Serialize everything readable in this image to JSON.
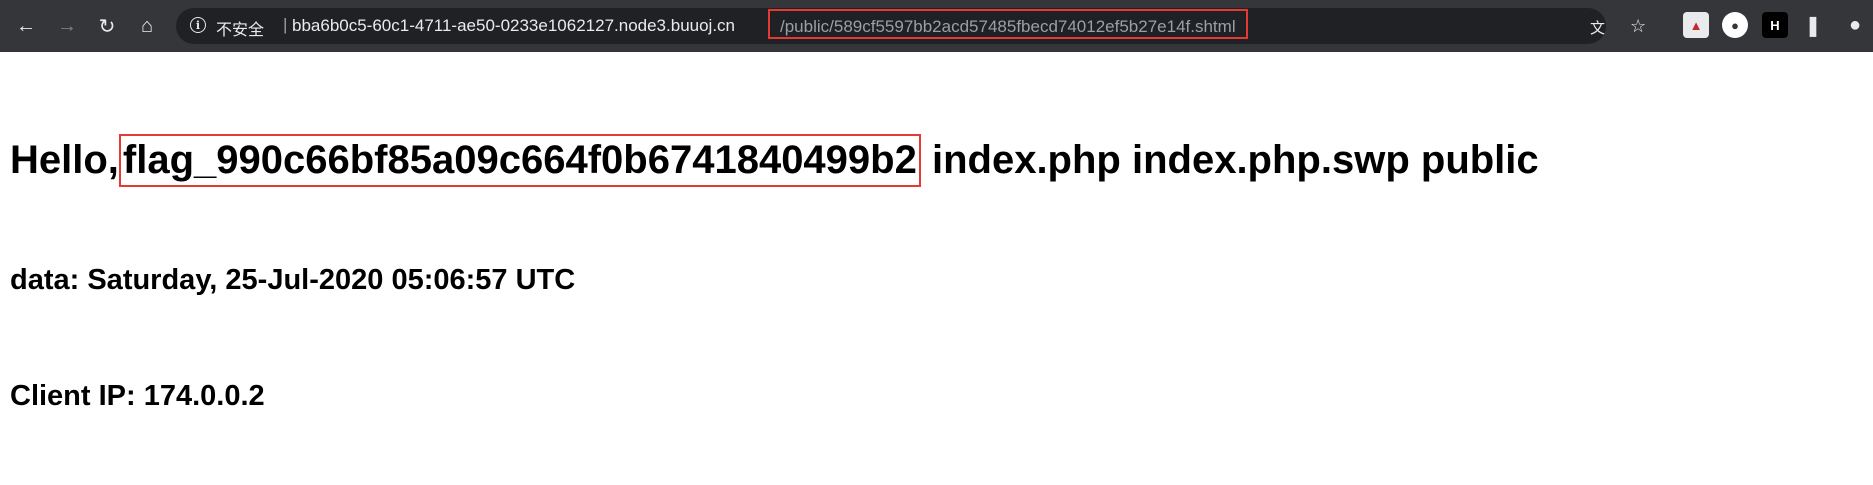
{
  "browser": {
    "security_label": "不安全",
    "separator": "|",
    "url_host": "bba6b0c5-60c1-4711-ae50-0233e1062127.node3.buuoj.cn",
    "url_path": "/public/589cf5597bb2acd57485fbecd74012ef5b27e14f.shtml",
    "icons": {
      "back": "arrow-left",
      "forward": "arrow-right",
      "reload": "reload",
      "home": "home",
      "info": "info",
      "translate": "translate",
      "bookmark": "star",
      "extensions": "puzzle-piece",
      "profile": "person"
    },
    "accent_color": "#e53935"
  },
  "page": {
    "hello_prefix": "Hello,",
    "flag": "flag_990c66bf85a09c664f0b6741840499b2",
    "hello_suffix": " index.php index.php.swp public",
    "date_line": "data: Saturday, 25-Jul-2020 05:06:57 UTC",
    "ip_line": "Client IP: 174.0.0.2"
  }
}
